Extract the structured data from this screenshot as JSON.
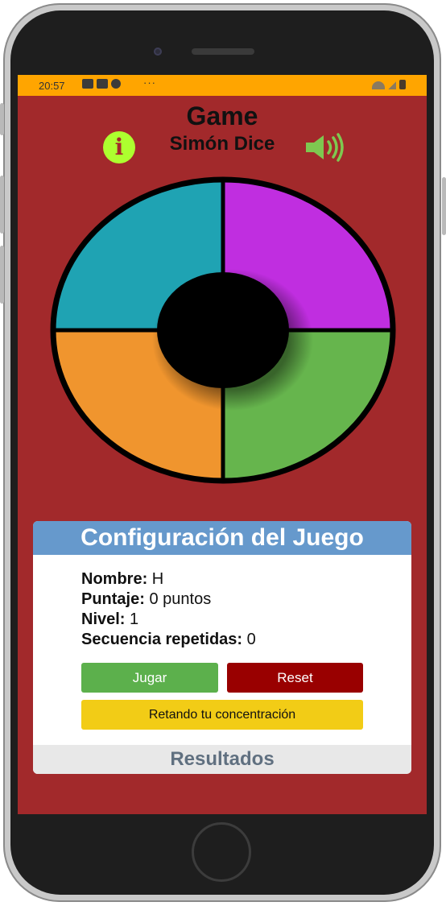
{
  "status_bar": {
    "time": "20:57",
    "more": "···",
    "icons": [
      "mail-icon",
      "youtube-icon",
      "twitter-icon"
    ],
    "right_icons": [
      "wifi-icon",
      "signal-icon",
      "battery-icon"
    ]
  },
  "header": {
    "title": "Game",
    "subtitle": "Simón Dice",
    "info_icon": "i"
  },
  "board": {
    "quadrants": [
      {
        "name": "blue",
        "color": "#1fa3b3"
      },
      {
        "name": "purple",
        "color": "#c02ee0"
      },
      {
        "name": "orange",
        "color": "#f0952e"
      },
      {
        "name": "green",
        "color": "#66b54d"
      }
    ]
  },
  "config": {
    "title": "Configuración del Juego",
    "name_label": "Nombre:",
    "name_value": " H",
    "score_label": "Puntaje:",
    "score_value": " 0 puntos",
    "level_label": "Nivel:",
    "level_value": " 1",
    "seq_label": "Secuencia repetidas:",
    "seq_value": " 0",
    "play_button": "Jugar",
    "reset_button": "Reset",
    "challenge_button": "Retando tu concentración",
    "results_label": "Resultados"
  },
  "colors": {
    "background": "#a2292b",
    "status_bar": "#ffa500",
    "accent_green": "#adff2f",
    "header_blue": "#6699cc"
  }
}
